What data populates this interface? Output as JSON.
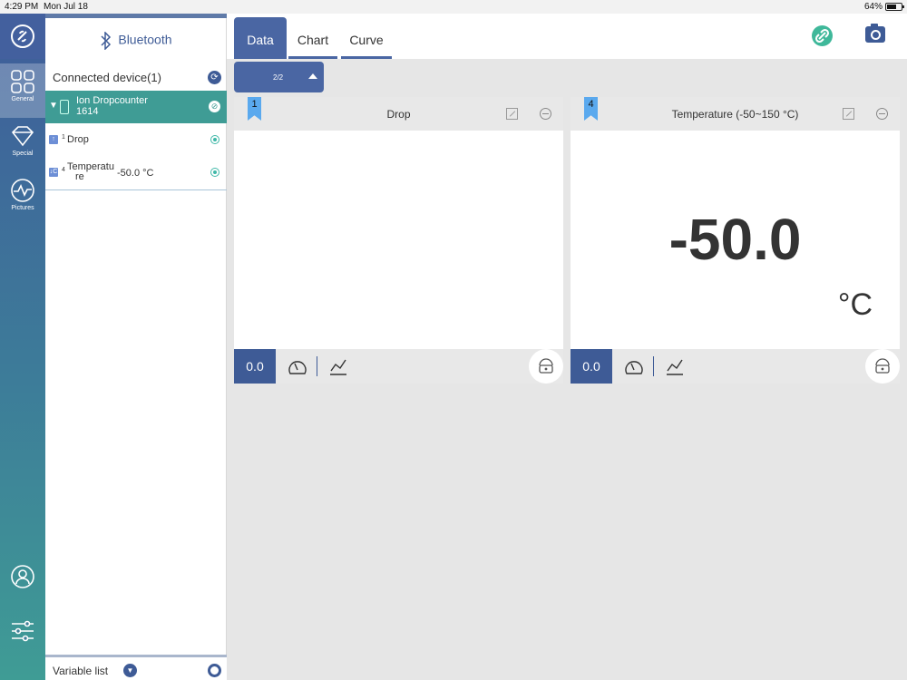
{
  "status_bar": {
    "time": "4:29 PM",
    "date": "Mon Jul 18",
    "battery": "64%"
  },
  "rail": {
    "items": [
      {
        "label": "General",
        "icon": "grid-icon"
      },
      {
        "label": "Special",
        "icon": "diamond-icon"
      },
      {
        "label": "Pictures",
        "icon": "wave-icon"
      }
    ]
  },
  "panel": {
    "title": "Bluetooth",
    "connected_label": "Connected device(1)",
    "device_name": "Ion Dropcounter",
    "device_id": "1614",
    "variables": [
      {
        "badge": "↑",
        "index": "1",
        "name": "Drop",
        "value": ""
      },
      {
        "badge": "↓C",
        "index": "4",
        "name_line1": "Temperatu",
        "name_line2": "re",
        "value": "-50.0 °C"
      }
    ],
    "variable_list_label": "Variable list"
  },
  "tabs": [
    {
      "label": "Data",
      "active": true
    },
    {
      "label": "Chart",
      "active": false
    },
    {
      "label": "Curve",
      "active": false
    }
  ],
  "pager": {
    "text": "2/2"
  },
  "cards": [
    {
      "flag": "1",
      "title": "Drop",
      "value": "",
      "unit": "",
      "footer_value": "0.0"
    },
    {
      "flag": "4",
      "title": "Temperature (-50~150 °C)",
      "value": "-50.0",
      "unit": "°C",
      "footer_value": "0.0"
    }
  ],
  "colors": {
    "primary": "#4a66a3",
    "teal": "#3f9c95",
    "accent_green": "#3fb89a"
  }
}
